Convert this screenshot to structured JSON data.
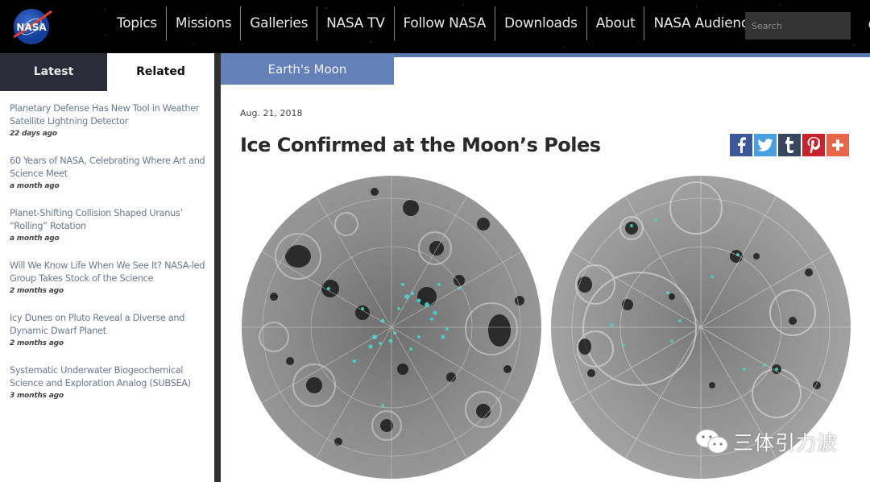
{
  "header": {
    "logo_text": "NASA",
    "nav": [
      {
        "label": "Topics"
      },
      {
        "label": "Missions"
      },
      {
        "label": "Galleries"
      },
      {
        "label": "NASA TV"
      },
      {
        "label": "Follow NASA"
      },
      {
        "label": "Downloads"
      },
      {
        "label": "About"
      },
      {
        "label": "NASA Audiences"
      }
    ],
    "search": {
      "placeholder": "Search",
      "value": "",
      "icon": "search-icon"
    }
  },
  "sidebar": {
    "tabs": [
      {
        "label": "Latest",
        "active": false
      },
      {
        "label": "Related",
        "active": true
      }
    ],
    "items": [
      {
        "title": "Planetary Defense Has New Tool in Weather Satellite Lightning Detector",
        "time": "22 days ago"
      },
      {
        "title": "60 Years of NASA, Celebrating Where Art and Science Meet",
        "time": "a month ago"
      },
      {
        "title": "Planet-Shifting Collision Shaped Uranus’ “Rolling” Rotation",
        "time": "a month ago"
      },
      {
        "title": "Will We Know Life When We See It? NASA-led Group Takes Stock of the Science",
        "time": "2 months ago"
      },
      {
        "title": "Icy Dunes on Pluto Reveal a Diverse and Dynamic Dwarf Planet",
        "time": "2 months ago"
      },
      {
        "title": "Systematic Underwater Biogeochemical Science and Exploration Analog (SUBSEA)",
        "time": "3 months ago"
      }
    ]
  },
  "article": {
    "category": "Earth's Moon",
    "date": "Aug. 21, 2018",
    "title": "Ice Confirmed at the Moon’s Poles",
    "share": [
      {
        "name": "facebook",
        "glyph": "f",
        "color": "#3b5998"
      },
      {
        "name": "twitter",
        "glyph": "t",
        "color": "#4a9fe0"
      },
      {
        "name": "tumblr",
        "glyph": "t",
        "color": "#36465d"
      },
      {
        "name": "pinterest",
        "glyph": "P",
        "color": "#c8232c"
      },
      {
        "name": "more",
        "glyph": "+",
        "color": "#e8654a"
      }
    ],
    "images": [
      {
        "alt": "Lunar south pole with ice deposits"
      },
      {
        "alt": "Lunar north pole with ice deposits"
      }
    ]
  },
  "watermark": {
    "text": "三体引力波"
  },
  "colors": {
    "header_bg": "#000000",
    "accent_blue": "#6480b8",
    "link_color": "#6b7893",
    "ice_cyan": "#3fd6d0"
  }
}
